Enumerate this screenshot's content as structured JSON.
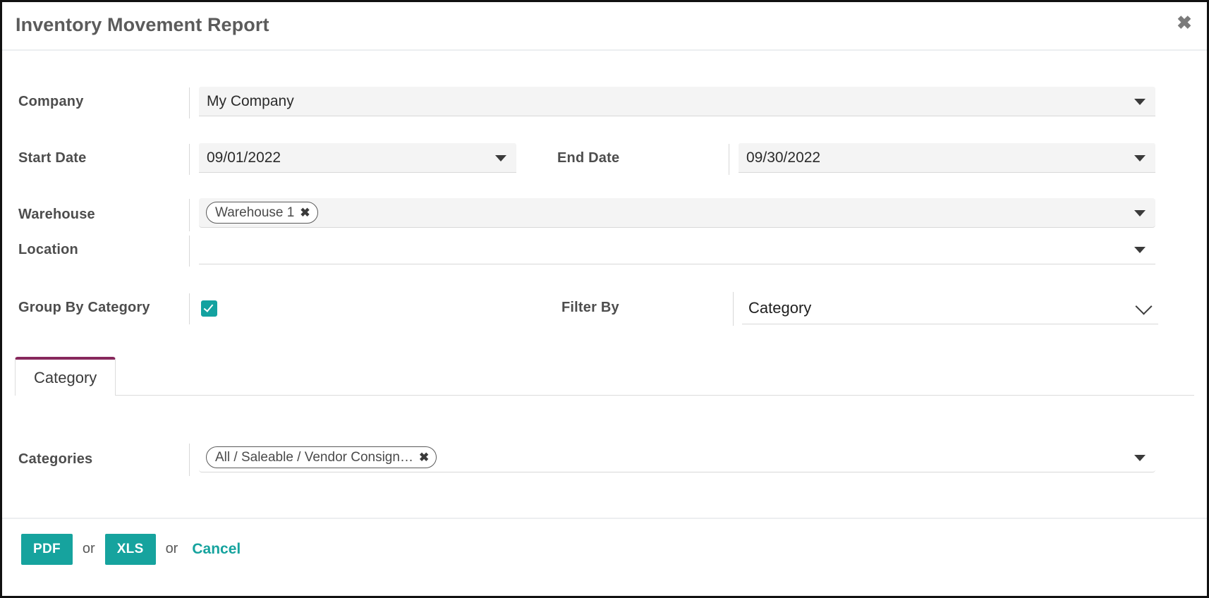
{
  "header": {
    "title": "Inventory Movement Report",
    "close_icon": "close-icon",
    "close_glyph": "✖"
  },
  "form": {
    "company": {
      "label": "Company",
      "value": "My Company",
      "arrow_icon": "triangle-down-icon"
    },
    "start_date": {
      "label": "Start Date",
      "value": "09/01/2022",
      "arrow_icon": "triangle-down-icon"
    },
    "end_date": {
      "label": "End Date",
      "value": "09/30/2022",
      "arrow_icon": "triangle-down-icon"
    },
    "warehouse": {
      "label": "Warehouse",
      "tags": [
        {
          "label": "Warehouse 1",
          "remove_glyph": "✖"
        }
      ],
      "arrow_icon": "triangle-down-icon"
    },
    "location": {
      "label": "Location",
      "value": "",
      "tags": [],
      "arrow_icon": "triangle-down-icon"
    },
    "group_by_category": {
      "label": "Group By Category",
      "checked": true,
      "check_glyph": "✓"
    },
    "filter_by": {
      "label": "Filter By",
      "value": "Category",
      "options": [
        "Category"
      ],
      "arrow_icon": "chevron-down-icon"
    }
  },
  "tabs": {
    "active_index": 0,
    "items": [
      {
        "label": "Category"
      }
    ],
    "active_border_color": "#87285c"
  },
  "category_panel": {
    "categories": {
      "label": "Categories",
      "tags": [
        {
          "label": "All / Saleable / Vendor Consign…",
          "remove_glyph": "✖"
        }
      ],
      "arrow_icon": "triangle-down-icon"
    }
  },
  "footer": {
    "pdf_label": "PDF",
    "or_label_1": "or",
    "xls_label": "XLS",
    "or_label_2": "or",
    "cancel_label": "Cancel"
  },
  "colors": {
    "accent_teal": "#16a39e",
    "tab_accent": "#87285c",
    "label_gray": "#4d4d4d"
  }
}
